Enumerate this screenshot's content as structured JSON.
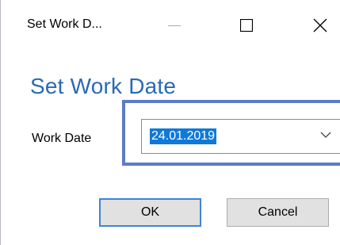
{
  "window": {
    "title": "Set Work D...",
    "controls": {
      "minimize_icon": "minimize-icon",
      "maximize_icon": "maximize-icon",
      "close_icon": "close-icon"
    }
  },
  "dialog": {
    "heading": "Set Work Date",
    "field_label": "Work Date",
    "date_value": "24.01.2019",
    "dropdown_icon": "chevron-down-icon",
    "ok_label": "OK",
    "cancel_label": "Cancel"
  },
  "colors": {
    "heading": "#2a6ab5",
    "focus_frame": "#5b7cc7",
    "selection": "#0f79d8",
    "ok_border": "#3e84d6",
    "button_face": "#e1e1e1"
  }
}
